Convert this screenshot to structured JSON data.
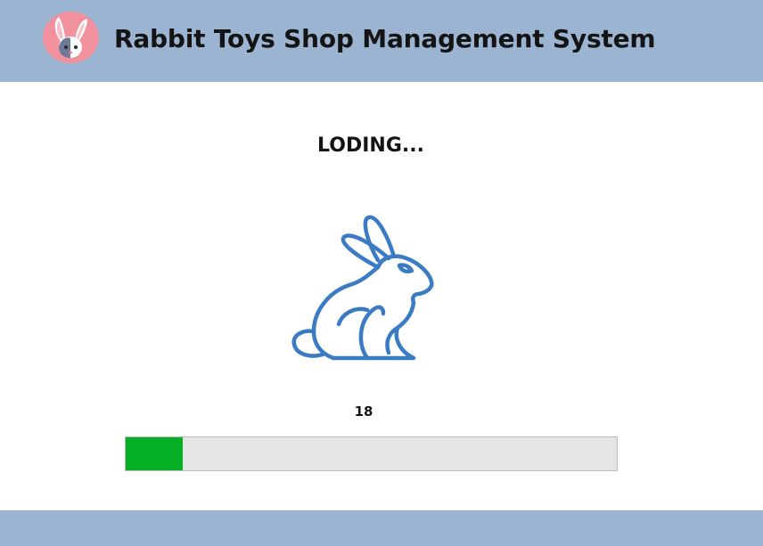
{
  "header": {
    "title": "Rabbit Toys Shop Management System",
    "logo_icon": "rabbit-logo-icon"
  },
  "main": {
    "loading_text": "LODING...",
    "illustration_icon": "rabbit-outline-icon",
    "progress": {
      "value_label": "18",
      "percent": 11.6
    }
  },
  "colors": {
    "header_bg": "#9ab4d2",
    "footer_bg": "#9ab4d2",
    "logo_bg": "#f2919e",
    "rabbit_stroke": "#3b7bc4",
    "progress_fill": "#06b025",
    "progress_track": "#e5e5e5"
  }
}
